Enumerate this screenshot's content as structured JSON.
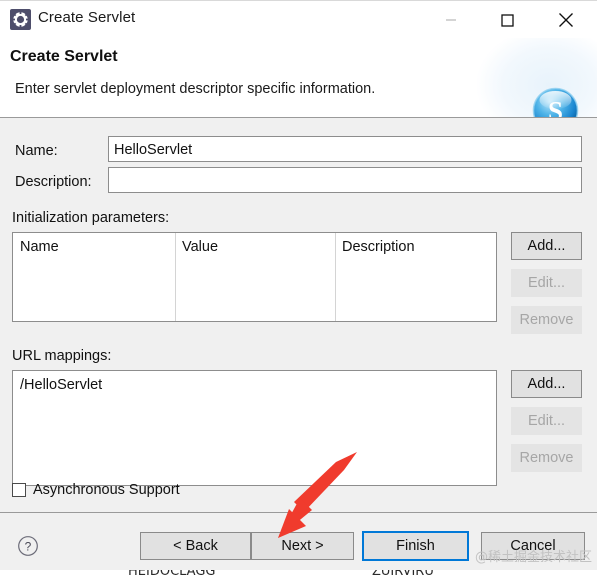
{
  "window": {
    "title": "Create Servlet",
    "icon": "servlet-gear-icon",
    "controls": {
      "minimize": "minimize-icon",
      "maximize": "maximize-icon",
      "close": "close-icon"
    }
  },
  "header": {
    "title": "Create Servlet",
    "description": "Enter servlet deployment descriptor specific information.",
    "logo": "blue-sphere-s-logo"
  },
  "form": {
    "name_label": "Name:",
    "name_value": "HelloServlet",
    "name_placeholder": "",
    "description_label": "Description:",
    "description_value": "",
    "description_placeholder": ""
  },
  "init_params": {
    "section_label": "Initialization parameters:",
    "columns": [
      "Name",
      "Value",
      "Description"
    ],
    "rows": [],
    "buttons": [
      {
        "label": "Add...",
        "enabled": true
      },
      {
        "label": "Edit...",
        "enabled": false
      },
      {
        "label": "Remove",
        "enabled": false
      }
    ]
  },
  "url_mappings": {
    "section_label": "URL mappings:",
    "rows": [
      "/HelloServlet"
    ],
    "buttons": [
      {
        "label": "Add...",
        "enabled": true
      },
      {
        "label": "Edit...",
        "enabled": false
      },
      {
        "label": "Remove",
        "enabled": false
      }
    ]
  },
  "options": {
    "async_support_label": "Asynchronous Support",
    "async_support_checked": false
  },
  "footer": {
    "help_icon": "help-question-icon",
    "back_label": "< Back",
    "next_label": "Next >",
    "finish_label": "Finish",
    "cancel_label": "Cancel",
    "focused_button": "Finish"
  },
  "annotation": {
    "arrow_color": "#f03b2d",
    "arrow_target": "Next >"
  },
  "watermark": {
    "text": "@稀土掘金技术社区"
  },
  "bleed": {
    "left_text": "HEIDOCLAGG",
    "right_text": "ZUIRVIRU"
  },
  "colors": {
    "dialog_background": "#f0f0f0",
    "header_background": "#ffffff",
    "field_background": "#ffffff",
    "border": "#8d8d8d",
    "focus_accent": "#0078d7",
    "disabled_text": "#a6a6a6",
    "arrow": "#f03b2d"
  }
}
